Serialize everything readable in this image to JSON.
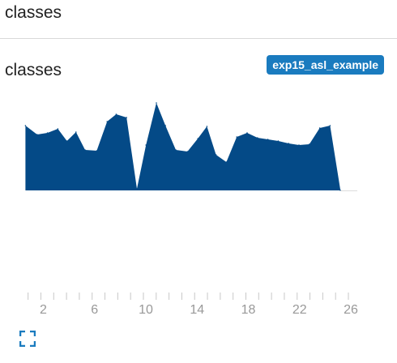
{
  "header": {
    "title": "classes"
  },
  "chart_title": "classes",
  "run_badge": {
    "label": "exp15_asl_example",
    "color": "#1a7bbf"
  },
  "expand_icon": {
    "name": "fullscreen-icon",
    "color": "#1a7bbf"
  },
  "colors": {
    "area": "#044a87",
    "tick_label": "#999999",
    "tick": "#c8c8c8",
    "baseline": "#dddddd"
  },
  "chart_data": {
    "type": "area",
    "title": "classes",
    "xlabel": "",
    "ylabel": "",
    "xlim": [
      0,
      27
    ],
    "ylim": [
      0,
      110
    ],
    "grid": false,
    "x_ticks": [
      2,
      4,
      6,
      8,
      10,
      12,
      14,
      16,
      18,
      20,
      22,
      24,
      26
    ],
    "x_tick_labels": [
      "2",
      "",
      "6",
      "",
      "10",
      "",
      "14",
      "",
      "18",
      "",
      "22",
      "",
      "26"
    ],
    "series": [
      {
        "x": [
          0.4,
          1.3,
          2.1,
          2.9,
          3.6,
          4.3,
          5.0,
          5.9,
          6.7,
          7.4,
          8.2,
          9.0,
          9.7,
          10.5,
          11.2,
          12.0,
          12.9,
          13.7,
          14.4,
          15.1,
          15.9,
          16.7,
          17.5,
          18.3,
          19.1,
          19.9,
          20.7,
          21.5,
          22.3,
          23.1,
          23.9,
          24.7
        ],
        "y": [
          80,
          69,
          71,
          76,
          61,
          72,
          50,
          49,
          85,
          94,
          90,
          2,
          56,
          108,
          80,
          50,
          48,
          64,
          79,
          44,
          35,
          66,
          71,
          65,
          63,
          61,
          58,
          56,
          57,
          77,
          80,
          0
        ]
      }
    ]
  }
}
